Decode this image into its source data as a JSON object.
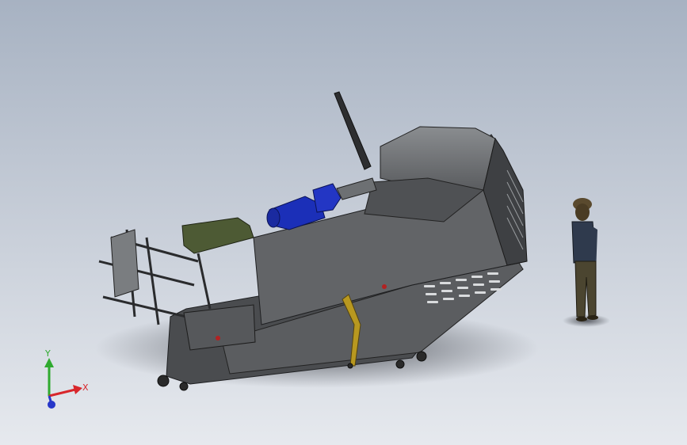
{
  "triad": {
    "x_label": "X",
    "y_label": "Y",
    "x_color": "#d8262b",
    "y_color": "#2faa2f",
    "z_color": "#2737c9"
  },
  "colors": {
    "body_dark": "#3f4144",
    "body_mid": "#55575a",
    "body_light": "#6c6f72",
    "motor_blue": "#1b2fb8",
    "olive_box": "#4d5a34",
    "worker_skin": "#5a4a2e"
  }
}
